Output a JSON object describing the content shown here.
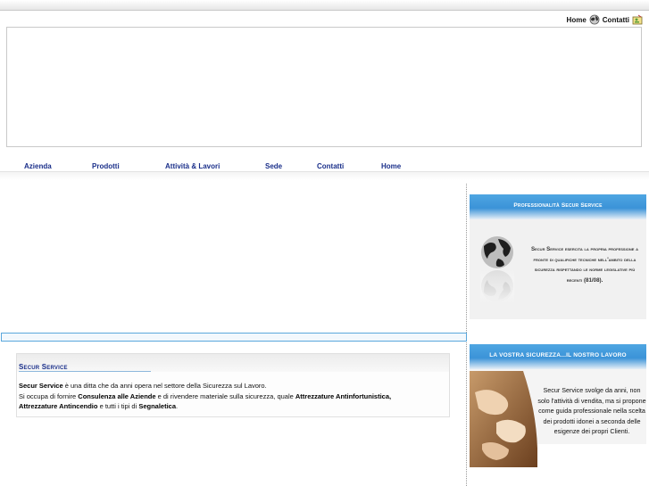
{
  "top_links": {
    "home": "Home",
    "contacts": "Contatti",
    "home_icon": "globe-icon",
    "contacts_icon": "contact-card-icon"
  },
  "nav": {
    "items": [
      "Azienda",
      "Prodotti",
      "Attività & Lavori",
      "Sede",
      "Contatti",
      "Home"
    ]
  },
  "content": {
    "title": "Secur Service",
    "brand": "Secur Service",
    "line1": " è una ditta che da anni opera nel settore della Sicurezza sul Lavoro.",
    "line2_a": "Si occupa di fornire ",
    "line2_b": "Consulenza alle Aziende",
    "line2_c": " e di rivendere materiale sulla sicurezza, quale ",
    "line2_d": "Attrezzature Antinfortunistica,",
    "line3_a": "Attrezzature Antincendio",
    "line3_b": " e tutti i tipi di ",
    "line3_c": "Segnaletica",
    "line3_d": "."
  },
  "side1": {
    "title": "Professionalità Secur Service",
    "text": "Secur Service esercita la propria professione a fronte di qualifiche tecniche nell'ambito della sicurezza rispettando le norme legislative più recenti",
    "text_suffix": "(81/08)."
  },
  "side2": {
    "title": "LA VOSTRA SICUREZZA...IL NOSTRO LAVORO",
    "text": "Secur Service svolge da anni, non solo l'attività di vendita, ma si propone come guida professionale nella scelta dei prodotti idonei a seconda delle esigenze dei propri Clienti."
  },
  "colors": {
    "nav_text": "#1a2f8a",
    "side_header": "#3b93d8",
    "bar_border": "#5aa7dc"
  }
}
